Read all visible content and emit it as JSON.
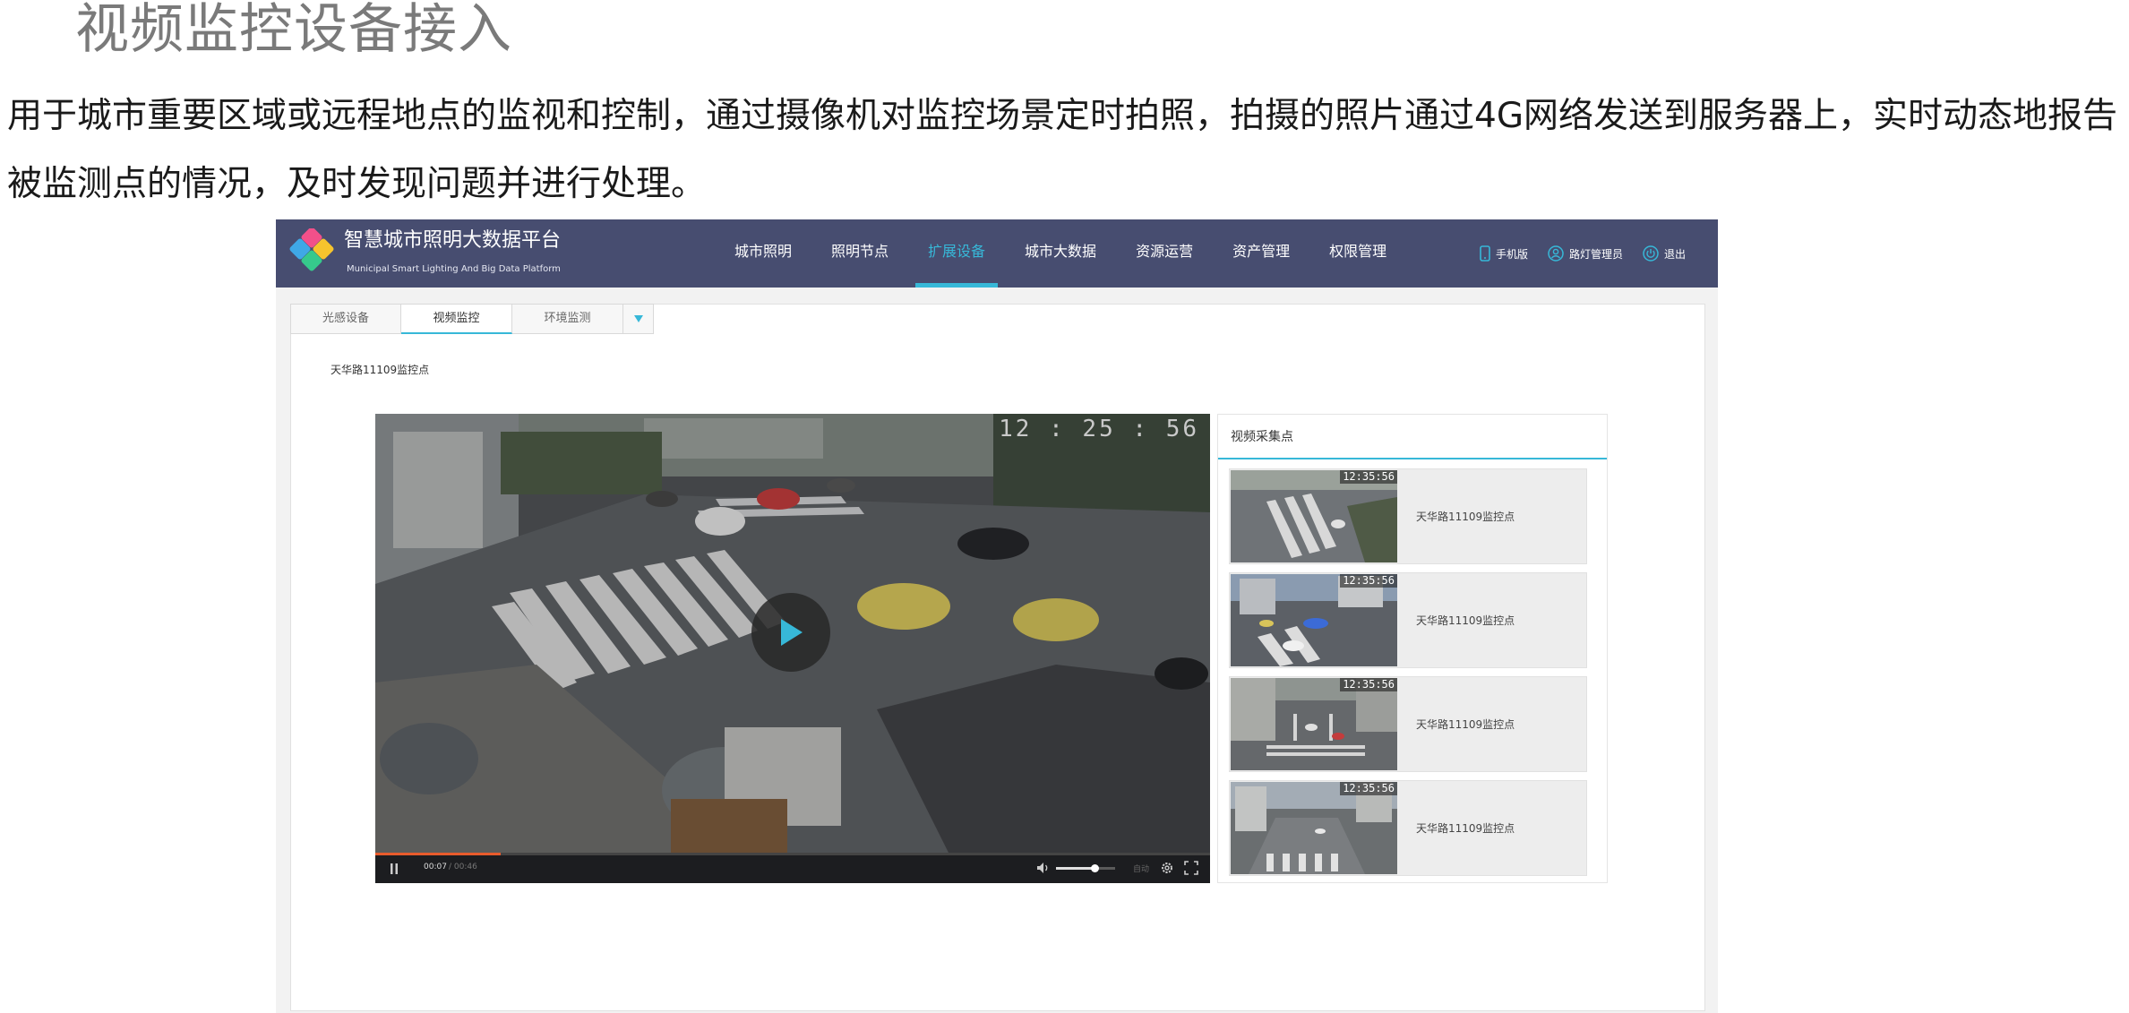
{
  "slide": {
    "title": "视频监控设备接入",
    "description": "用于城市重要区域或远程地点的监视和控制，通过摄像机对监控场景定时拍照，拍摄的照片通过4G网络发送到服务器上，实时动态地报告被监测点的情况，及时发现问题并进行处理。"
  },
  "header": {
    "brand_cn": "智慧城市照明大数据平台",
    "brand_en": "Municipal Smart Lighting And  Big Data Platform",
    "nav": [
      {
        "label": "城市照明",
        "active": false
      },
      {
        "label": "照明节点",
        "active": false
      },
      {
        "label": "扩展设备",
        "active": true
      },
      {
        "label": "城市大数据",
        "active": false
      },
      {
        "label": "资源运营",
        "active": false
      },
      {
        "label": "资产管理",
        "active": false
      },
      {
        "label": "权限管理",
        "active": false
      }
    ],
    "actions": {
      "mobile": "手机版",
      "admin": "路灯管理员",
      "logout": "退出"
    },
    "accent_color": "#37b8d8",
    "bar_color": "#474d70"
  },
  "tabs": [
    {
      "label": "光感设备",
      "active": false
    },
    {
      "label": "视频监控",
      "active": true
    },
    {
      "label": "环境监测",
      "active": false
    }
  ],
  "location_title": "天华路11109监控点",
  "video": {
    "timestamp": "12 : 25 : 56",
    "current_time": "00:07",
    "total_time": "/ 00:46",
    "progress": 0.15,
    "volume": 0.65,
    "quality_label": "自动"
  },
  "side_panel": {
    "title": "视频采集点",
    "items": [
      {
        "time": "12:35:56",
        "label": "天华路11109监控点"
      },
      {
        "time": "12:35:56",
        "label": "天华路11109监控点"
      },
      {
        "time": "12:35:56",
        "label": "天华路11109监控点"
      },
      {
        "time": "12:35:56",
        "label": "天华路11109监控点"
      }
    ]
  }
}
